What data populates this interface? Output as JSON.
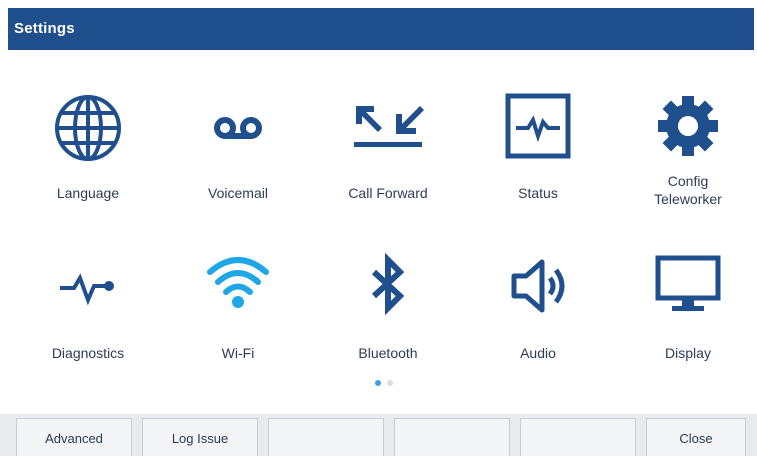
{
  "title_bar": {
    "title": "Settings"
  },
  "apps": [
    {
      "label": "Language",
      "icon": "globe-icon"
    },
    {
      "label": "Voicemail",
      "icon": "voicemail-icon"
    },
    {
      "label": "Call Forward",
      "icon": "call-forward-icon"
    },
    {
      "label": "Status",
      "icon": "status-monitor-icon"
    },
    {
      "label": "Config\nTeleworker",
      "icon": "gear-icon"
    },
    {
      "label": "Diagnostics",
      "icon": "pulse-icon"
    },
    {
      "label": "Wi-Fi",
      "icon": "wifi-icon"
    },
    {
      "label": "Bluetooth",
      "icon": "bluetooth-icon"
    },
    {
      "label": "Audio",
      "icon": "speaker-icon"
    },
    {
      "label": "Display",
      "icon": "monitor-icon"
    }
  ],
  "pagination": {
    "current_page": 1,
    "total_pages": 2
  },
  "softkeys": [
    {
      "label": "Advanced"
    },
    {
      "label": "Log Issue"
    },
    {
      "label": ""
    },
    {
      "label": ""
    },
    {
      "label": ""
    },
    {
      "label": "Close"
    }
  ],
  "colors": {
    "title_bar": "#1f4f8c",
    "icon": "#1f4f8c",
    "wifi_icon": "#1ea6e6",
    "active_dot": "#3ea0e0",
    "label_text": "#2e3b55"
  }
}
